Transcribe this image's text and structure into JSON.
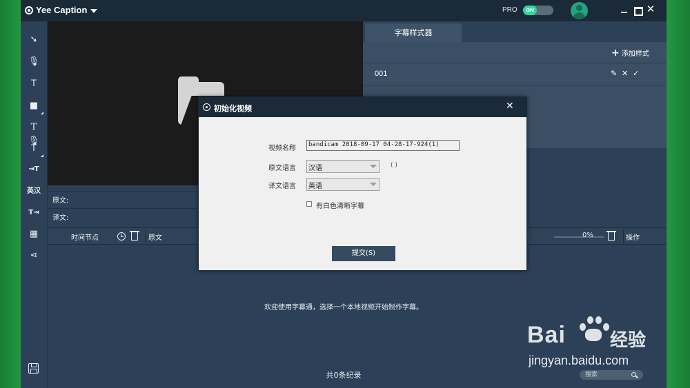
{
  "app": {
    "title": "Yee Caption",
    "pro_label": "PRO",
    "pro_toggle_text": "ON"
  },
  "toolbar": {
    "icons": [
      "select-icon",
      "microphone-icon",
      "text-icon",
      "shape-icon",
      "text-voice-icon",
      "text-box-icon",
      "text-insert-icon",
      "translate-icon",
      "text-export-icon",
      "film-icon",
      "share-icon",
      "save-icon"
    ]
  },
  "style_panel": {
    "tab_label": "字幕样式器",
    "add_label": "添加样式",
    "rows": [
      {
        "name": "001"
      }
    ]
  },
  "fields": {
    "original_label": "原文:",
    "translation_label": "译文:"
  },
  "table": {
    "col_time": "时间节点",
    "col_original": "原文",
    "progress_text": "0%",
    "progress_value": 0,
    "col_actions": "操作"
  },
  "main": {
    "welcome_text": "欢迎使用字幕通，选择一个本地视频开始制作字幕。",
    "record_count": "共0条纪录",
    "search_placeholder": "搜索"
  },
  "dialog": {
    "title": "初始化视频",
    "video_name_label": "视频名称",
    "video_name_value": "bandicam 2018-09-17 04-28-17-924(1)",
    "source_lang_label": "原文语言",
    "source_lang_value": "汉语",
    "source_lang_note": "( )",
    "target_lang_label": "译文语言",
    "target_lang_value": "英语",
    "white_bg_label": "有白色清晰字幕",
    "submit_label": "提交(S)"
  },
  "watermark": {
    "brand": "Bai",
    "brand2": "经验",
    "url": "jingyan.baidu.com"
  },
  "colors": {
    "titlebar": "#1b2a38",
    "app_bg": "#2c4157",
    "panel": "#3a4f63",
    "toggle_on": "#2fd6a0",
    "dialog_bg": "#f0f0f0",
    "submit_button": "#354b60"
  }
}
